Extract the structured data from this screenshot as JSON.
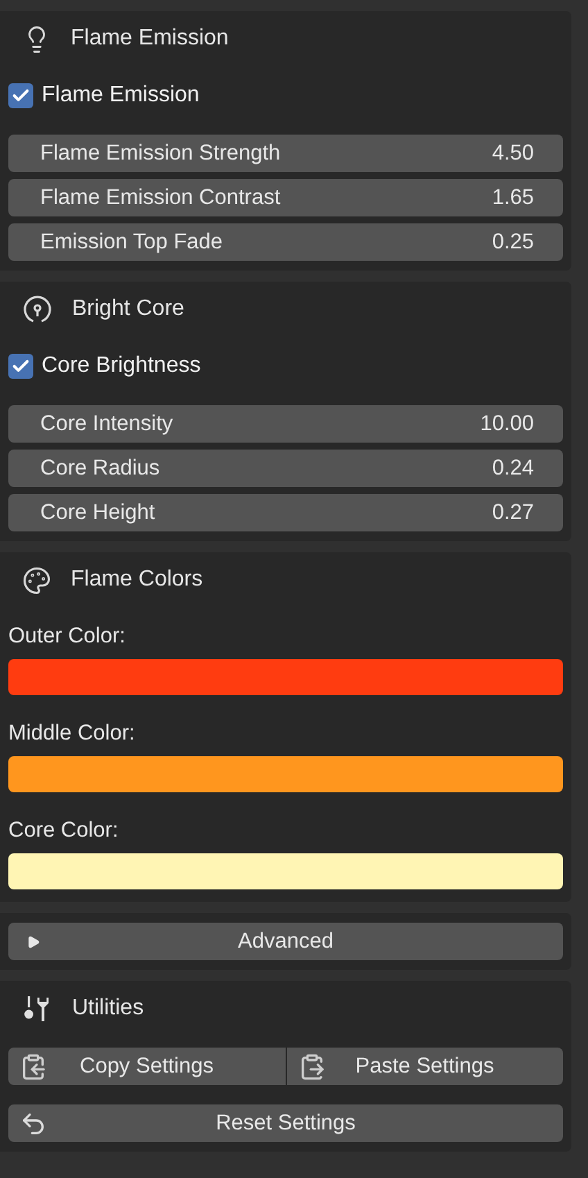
{
  "panels": [
    {
      "kind": "properties",
      "title": "Flame Emission",
      "toggle": {
        "label": "Flame Emission",
        "checked": true
      },
      "fields": [
        {
          "label": "Flame Emission Strength",
          "value": "4.50"
        },
        {
          "label": "Flame Emission Contrast",
          "value": "1.65"
        },
        {
          "label": "Emission Top Fade",
          "value": "0.25"
        }
      ]
    },
    {
      "kind": "properties",
      "title": "Bright Core",
      "toggle": {
        "label": "Core Brightness",
        "checked": true
      },
      "fields": [
        {
          "label": "Core Intensity",
          "value": "10.00"
        },
        {
          "label": "Core Radius",
          "value": "0.24"
        },
        {
          "label": "Core Height",
          "value": "0.27"
        }
      ]
    },
    {
      "kind": "colors",
      "title": "Flame Colors",
      "swatches": [
        {
          "label": "Outer Color:",
          "color": "#ff3c10"
        },
        {
          "label": "Middle Color:",
          "color": "#ff961e"
        },
        {
          "label": "Core Color:",
          "color": "#fff5b4"
        }
      ]
    },
    {
      "kind": "collapsed",
      "title": "Advanced",
      "expanded": false
    },
    {
      "kind": "utilities",
      "title": "Utilities",
      "buttons": [
        {
          "label": "Copy Settings"
        },
        {
          "label": "Paste Settings"
        }
      ],
      "reset": {
        "label": "Reset Settings"
      }
    }
  ]
}
